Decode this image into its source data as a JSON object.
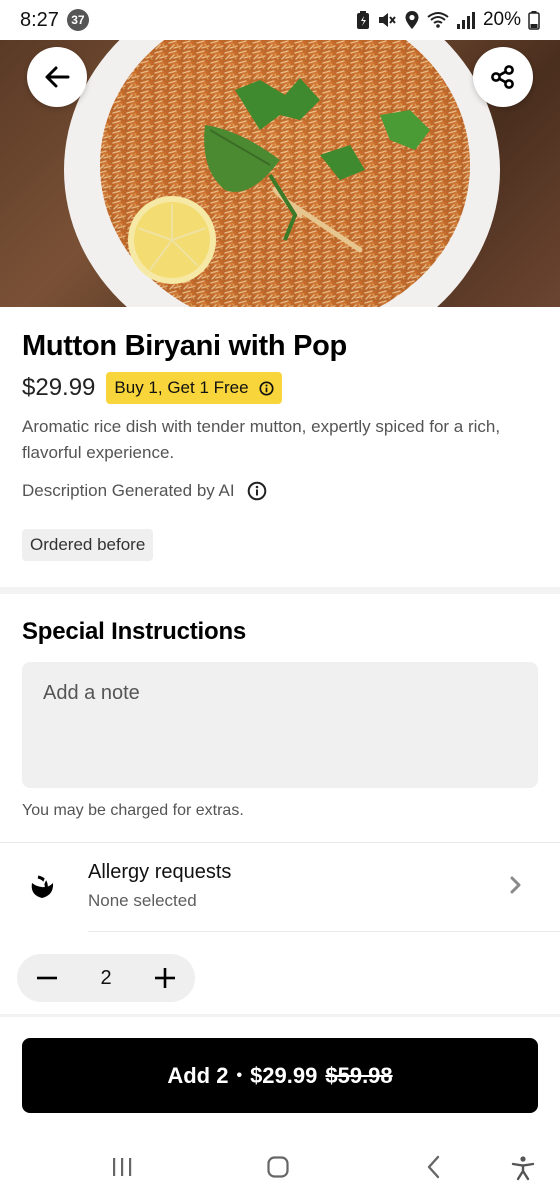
{
  "status_bar": {
    "time": "8:27",
    "notification_count": "37",
    "battery": "20%"
  },
  "item": {
    "title": "Mutton Biryani with Pop",
    "price": "$29.99",
    "promo": "Buy 1, Get 1 Free",
    "description": "Aromatic rice dish with tender mutton, expertly spiced for a rich, flavorful experience.",
    "ai_note": "Description Generated by AI",
    "ordered_before": "Ordered before"
  },
  "special_instructions": {
    "title": "Special Instructions",
    "placeholder": "Add a note",
    "extras_note": "You may be charged for extras."
  },
  "allergy": {
    "title": "Allergy requests",
    "subtitle": "None selected"
  },
  "quantity": {
    "value": "2"
  },
  "add_button": {
    "label": "Add 2",
    "separator": "•",
    "price": "$29.99",
    "original_price": "$59.98"
  },
  "colors": {
    "promo_yellow": "#f8d53a",
    "primary_button": "#000000"
  }
}
